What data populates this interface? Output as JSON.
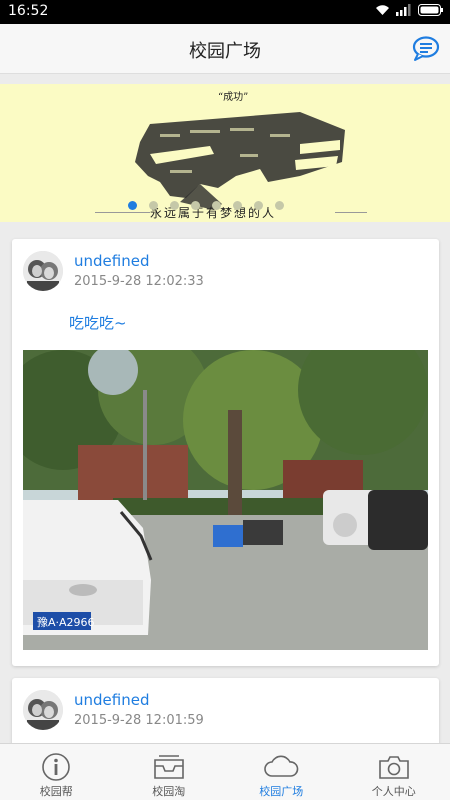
{
  "status": {
    "time": "16:52"
  },
  "header": {
    "title": "校园广场",
    "message_icon": "chat-bubble-icon"
  },
  "banner": {
    "headline": "成功",
    "caption": "永远属于有梦想的人",
    "dot_count": 8,
    "active_dot": 0
  },
  "posts": [
    {
      "user": "undefined",
      "date": "2015-9-28 12:02:33",
      "text": "吃吃吃~",
      "plate": "豫A·A2966"
    },
    {
      "user": "undefined",
      "date": "2015-9-28 12:01:59"
    }
  ],
  "tabs": [
    {
      "label": "校园帮",
      "icon": "info-icon"
    },
    {
      "label": "校园淘",
      "icon": "tray-icon"
    },
    {
      "label": "校园广场",
      "icon": "cloud-icon"
    },
    {
      "label": "个人中心",
      "icon": "camera-icon"
    }
  ],
  "colors": {
    "accent": "#1f7de0",
    "banner_bg": "#fbfbc4"
  }
}
